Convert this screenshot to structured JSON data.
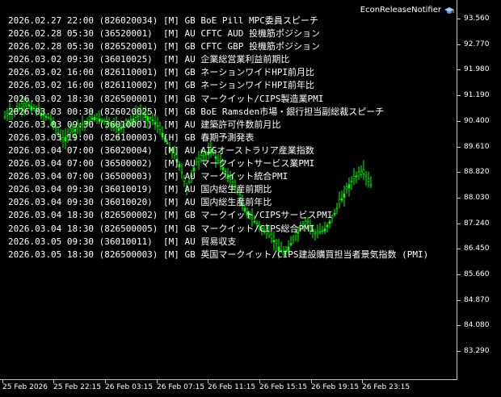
{
  "ea_name": "EconReleaseNotifier",
  "ea_icon": "graduation-cap-icon",
  "colors": {
    "candle": "#00ff00",
    "background": "#000000",
    "axis": "#c8c8c8",
    "text": "#ffffff"
  },
  "events": [
    "2026.02.27 22:00 (826020034) [M] GB BoE Pill MPC委員スピーチ",
    "2026.02.28 05:30 (36520001)  [M] AU CFTC AUD 投機筋ポジション",
    "2026.02.28 05:30 (826520001) [M] GB CFTC GBP 投機筋ポジション",
    "2026.03.02 09:30 (36010025)  [M] AU 企業総営業利益前期比",
    "2026.03.02 16:00 (826110001) [M] GB ネーションワイドHPI前月比",
    "2026.03.02 16:00 (826110002) [M] GB ネーションワイドHPI前年比",
    "2026.03.02 18:30 (826500001) [M] GB マークイット/CIPS製造業PMI",
    "2026.03.03 00:30 (826020025) [M] GB BoE Ramsden市場・銀行担当副総裁スピーチ",
    "2026.03.03 09:30 (36010001)  [M] AU 建築許可件数前月比",
    "2026.03.03 19:00 (826100003) [H] GB 春期予測発表",
    "2026.03.04 07:00 (36020004)  [M] AU AIGオーストラリア産業指数",
    "2026.03.04 07:00 (36500002)  [M] AU マークイットサービス業PMI",
    "2026.03.04 07:00 (36500003)  [M] AU マークイット統合PMI",
    "2026.03.04 09:30 (36010019)  [M] AU 国内総生産前期比",
    "2026.03.04 09:30 (36010020)  [M] AU 国内総生産前年比",
    "2026.03.04 18:30 (826500002) [M] GB マークイット/CIPSサービスPMI",
    "2026.03.04 18:30 (826500005) [M] GB マークイット/CIPS総合PMI",
    "2026.03.05 09:30 (36010011)  [M] AU 貿易収支",
    "2026.03.05 18:30 (826500003) [M] GB 英国マークイット/CIPS建設購買担当者景気指数 (PMI)"
  ],
  "price_axis": [
    "93.560",
    "92.770",
    "91.980",
    "91.190",
    "90.400",
    "89.610",
    "88.820",
    "88.030",
    "87.240",
    "86.450",
    "85.660",
    "84.870",
    "84.080",
    "83.290"
  ],
  "time_axis": [
    "25 Feb 2026",
    "25 Feb 22:15",
    "26 Feb 03:15",
    "26 Feb 07:15",
    "26 Feb 11:15",
    "26 Feb 15:15",
    "26 Feb 19:15",
    "26 Feb 23:15"
  ],
  "price_range": [
    82.61,
    94.23
  ]
}
